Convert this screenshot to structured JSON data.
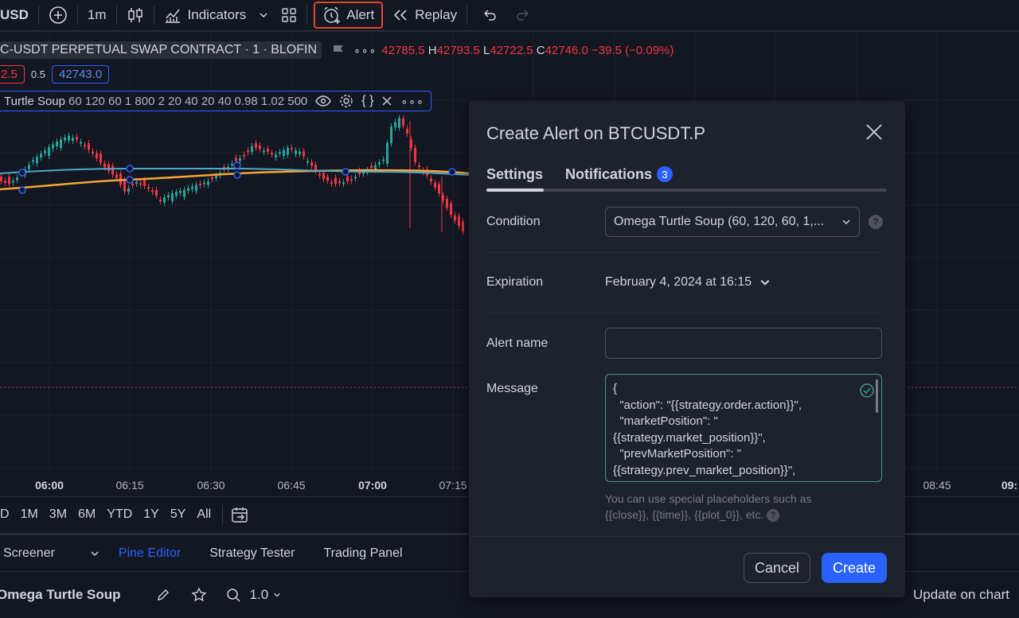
{
  "toolbar": {
    "symbol_fragment": "USD",
    "interval": "1m",
    "indicators_label": "Indicators",
    "alert_label": "Alert",
    "replay_label": "Replay"
  },
  "legend": {
    "title": "C-USDT PERPETUAL SWAP CONTRACT",
    "interval": "1",
    "exchange": "BLOFIN",
    "ohlc": {
      "open": "42785.5",
      "high_label": "H",
      "high": "42793.5",
      "low_label": "L",
      "low": "42722.5",
      "close_label": "C",
      "close": "42746.0",
      "change": "−39.5 (−0.09%)"
    },
    "sell_price": "2.5",
    "spread": "0.5",
    "buy_price": "42743.0"
  },
  "indicator": {
    "name": "Turtle Soup",
    "params": "60 120 60 1 800 2 20 40 20 40 0.98 1.02 500"
  },
  "time_axis": [
    {
      "label": "06:00",
      "bold": true
    },
    {
      "label": "06:15",
      "bold": false
    },
    {
      "label": "06:30",
      "bold": false
    },
    {
      "label": "06:45",
      "bold": false
    },
    {
      "label": "07:00",
      "bold": true
    },
    {
      "label": "07:15",
      "bold": false
    },
    {
      "label": "08:45",
      "bold": false
    },
    {
      "label": "09:",
      "bold": true
    }
  ],
  "ranges": [
    "D",
    "1M",
    "3M",
    "6M",
    "YTD",
    "1Y",
    "5Y",
    "All"
  ],
  "panel_tabs": {
    "screener": "Screener",
    "pine_editor": "Pine Editor",
    "strategy_tester": "Strategy Tester",
    "trading_panel": "Trading Panel"
  },
  "editor": {
    "script_name": "Omega Turtle Soup",
    "version": "1.0",
    "update_label": "Update on chart"
  },
  "dialog": {
    "title": "Create Alert on BTCUSDT.P",
    "tab_settings": "Settings",
    "tab_notifications": "Notifications",
    "notifications_count": "3",
    "condition_label": "Condition",
    "condition_value": "Omega Turtle Soup (60, 120, 60, 1,...",
    "expiration_label": "Expiration",
    "expiration_value": "February 4, 2024 at 16:15",
    "alert_name_label": "Alert name",
    "alert_name_value": "",
    "message_label": "Message",
    "message_lines": [
      "{",
      "  \"action\": \"{{strategy.order.action}}\",",
      "  \"marketPosition\": \"",
      "{{strategy.market_position}}\",",
      "  \"prevMarketPosition\": \"",
      "{{strategy.prev_market_position}}\","
    ],
    "hint_line1": "You can use special placeholders such as",
    "hint_line2": "{{close}}, {{time}}, {{plot_0}}, etc.",
    "cancel_label": "Cancel",
    "create_label": "Create"
  },
  "colors": {
    "background": "#131722",
    "dialog": "#1e222d",
    "accent": "#2962ff",
    "alert_highlight": "#e0482f",
    "down": "#f23645",
    "up": "#26a69a",
    "ma_blue": "#4fa8c9",
    "ma_orange": "#f7a535"
  }
}
